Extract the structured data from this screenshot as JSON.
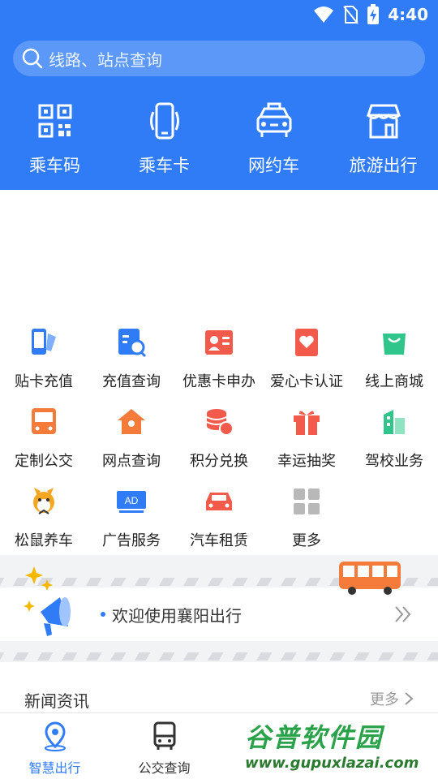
{
  "status_bar": {
    "time": "4:40"
  },
  "search": {
    "placeholder": "线路、站点查询"
  },
  "top_nav": [
    {
      "label": "乘车码",
      "icon": "qr-code-icon"
    },
    {
      "label": "乘车卡",
      "icon": "phone-card-icon"
    },
    {
      "label": "网约车",
      "icon": "car-icon"
    },
    {
      "label": "旅游出行",
      "icon": "store-icon"
    }
  ],
  "services": [
    {
      "label": "贴卡充值",
      "icon": "phone-card-recharge-icon",
      "color": "#2f7cf6"
    },
    {
      "label": "充值查询",
      "icon": "recharge-search-icon",
      "color": "#2f7cf6"
    },
    {
      "label": "优惠卡申办",
      "icon": "id-card-icon",
      "color": "#f25a4b"
    },
    {
      "label": "爱心卡认证",
      "icon": "heart-card-icon",
      "color": "#f25a4b"
    },
    {
      "label": "线上商城",
      "icon": "shopping-bag-icon",
      "color": "#2fc58b"
    },
    {
      "label": "定制公交",
      "icon": "bus-icon",
      "color": "#f47b3a"
    },
    {
      "label": "网点查询",
      "icon": "house-location-icon",
      "color": "#f47b3a"
    },
    {
      "label": "积分兑换",
      "icon": "coins-icon",
      "color": "#f25a4b"
    },
    {
      "label": "幸运抽奖",
      "icon": "gift-icon",
      "color": "#f25a4b"
    },
    {
      "label": "驾校业务",
      "icon": "building-icon",
      "color": "#2fc58b"
    },
    {
      "label": "松鼠养车",
      "icon": "squirrel-icon",
      "color": "#f5a623"
    },
    {
      "label": "广告服务",
      "icon": "ad-icon",
      "color": "#2f7cf6"
    },
    {
      "label": "汽车租赁",
      "icon": "rental-car-icon",
      "color": "#f25a4b"
    },
    {
      "label": "更多",
      "icon": "grid-more-icon",
      "color": "#b8b8b8"
    }
  ],
  "banner": {
    "text": "欢迎使用襄阳出行"
  },
  "news": {
    "title": "新闻资讯",
    "more": "更多"
  },
  "tabbar": [
    {
      "label": "智慧出行",
      "icon": "location-pin-icon",
      "active": true
    },
    {
      "label": "公交查询",
      "icon": "bus-front-icon",
      "active": false
    }
  ],
  "watermark": {
    "text": "谷普软件园",
    "url": "www.gupuxlazai.com"
  },
  "colors": {
    "primary": "#2f7cf6",
    "orange": "#f47b3a",
    "red": "#f25a4b",
    "green": "#2fc58b"
  }
}
